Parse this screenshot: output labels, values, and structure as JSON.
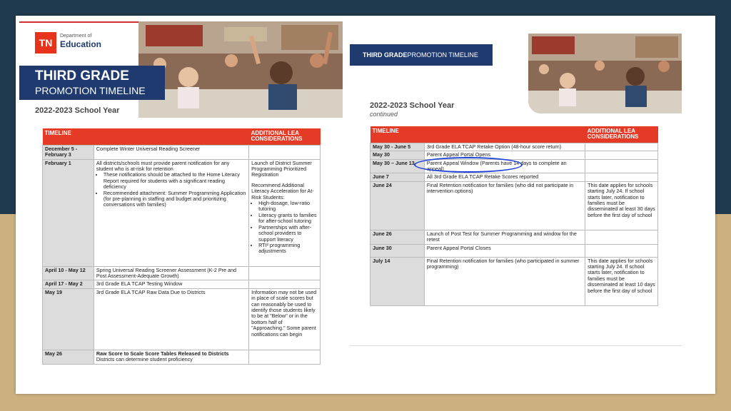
{
  "left": {
    "logo": {
      "abbr": "TN",
      "line1": "Department of",
      "line2": "Education"
    },
    "title1": "THIRD GRADE",
    "title2": "PROMOTION TIMELINE",
    "school_year": "2022-2023 School Year",
    "headers": [
      "TIMELINE",
      "",
      "ADDITIONAL LEA CONSIDERATIONS"
    ],
    "rows": [
      {
        "date": "December 5 - February 3",
        "desc": "Complete Winter Universal Reading Screener",
        "extra": ""
      },
      {
        "date": "February 1",
        "desc": "All districts/schools must provide parent notification for any student who is at-risk for retention",
        "bullets": [
          "These notifications should be attached to the Home Literacy Report required for students with a significant reading deficiency",
          "Recommended attachment: Summer Programming Application (for pre-planning in staffing and budget and prioritizing conversations with families)"
        ],
        "extra": "Launch of District Summer Programming Prioritized Registration",
        "extra2": "Recommend Additional Literacy Acceleration for At-Risk Students:",
        "extra_bullets": [
          "High-dosage, low-ratio tutoring",
          "Literacy grants to families for after-school tutoring",
          "Partnerships with after-school providers to support literacy",
          "RTI² programming adjustments"
        ]
      },
      {
        "date": "April 10 - May 12",
        "desc": "Spring Universal Reading Screener Assessment (K-2 Pre and Post Assessment-Adequate Growth)",
        "extra": ""
      },
      {
        "date": "April 17 - May 2",
        "desc": "3rd Grade ELA TCAP Testing Window",
        "extra": ""
      },
      {
        "date": "May 19",
        "desc": "3rd Grade ELA TCAP Raw Data Due to Districts",
        "extra": "Information may not be used in place of scale scores but can reasonably be used to identify those students likely to be at \"Below\" or in the bottom half of \"Approaching.\" Some parent notifications can begin"
      },
      {
        "date": "May 26",
        "desc": "Raw Score to Scale Score Tables Released to Districts",
        "desc2": "Districts can determine student proficiency",
        "extra": ""
      }
    ]
  },
  "right": {
    "title_bold": "THIRD GRADE",
    "title_rest": " PROMOTION TIMELINE",
    "school_year": "2022-2023 School Year",
    "continued": "continued",
    "headers": [
      "TIMELINE",
      "",
      "ADDITIONAL LEA CONSIDERATIONS"
    ],
    "rows": [
      {
        "date": "May 30 - June 5",
        "desc": "3rd Grade ELA TCAP Retake Option (48-hour score return)",
        "extra": ""
      },
      {
        "date": "May 30",
        "desc": "Parent Appeal Portal Opens",
        "extra": ""
      },
      {
        "date": "May 30 – June 13",
        "desc": "Parent Appeal Window (Parents have 14 days to complete an appeal)",
        "extra": ""
      },
      {
        "date": "June 7",
        "desc": "All 3rd Grade ELA TCAP Retake Scores reported",
        "extra": ""
      },
      {
        "date": "June 24",
        "desc": "Final Retention notification for families (who did not participate in intervention options)",
        "extra": "This date applies for schools starting July 24. If school starts later, notification to families must be disseminated at least 30 days before the first day of school"
      },
      {
        "date": "June 26",
        "desc": "Launch of Post Test for Summer Programming and window for the retest",
        "extra": ""
      },
      {
        "date": "June 30",
        "desc": "Parent Appeal Portal Closes",
        "extra": ""
      },
      {
        "date": "July 14",
        "desc": "Final Retention notification for families (who participated in summer programming)",
        "extra": "This date applies for schools starting July 24. If school starts later, notification to families must be disseminated at least 10 days before the first day of school"
      }
    ]
  },
  "colors": {
    "navy": "#1f3a6e",
    "red": "#e53a26",
    "highlight": "#1a3fd6"
  }
}
